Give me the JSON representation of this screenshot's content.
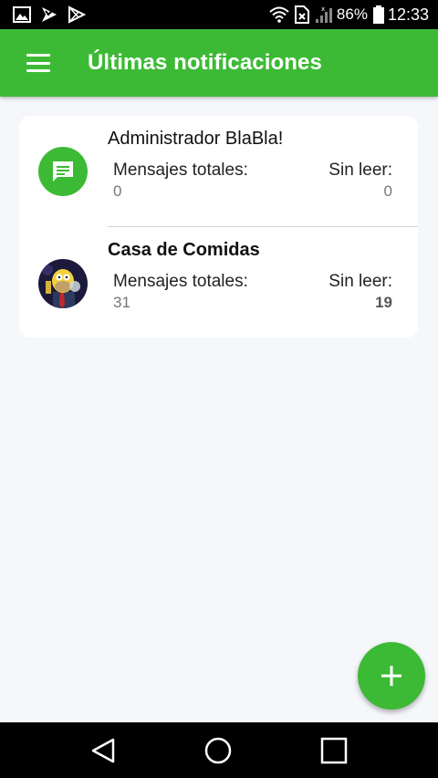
{
  "status_bar": {
    "battery_percent": "86%",
    "time": "12:33",
    "icons": [
      "image-icon",
      "download-icon",
      "play-store-icon",
      "wifi-icon",
      "sim-error-icon",
      "signal-icon",
      "battery-icon"
    ]
  },
  "app_bar": {
    "title": "Últimas notificaciones",
    "menu_icon": "menu-icon"
  },
  "notifications": [
    {
      "name": "Administrador BlaBla!",
      "avatar": "chat-icon",
      "total_label": "Mensajes totales:",
      "total_value": "0",
      "unread_label": "Sin leer:",
      "unread_value": "0",
      "bold": false
    },
    {
      "name": "Casa de Comidas",
      "avatar": "cartoon-avatar",
      "total_label": "Mensajes totales:",
      "total_value": "31",
      "unread_label": "Sin leer:",
      "unread_value": "19",
      "bold": true
    }
  ],
  "fab": {
    "icon": "plus-icon"
  },
  "nav_bar": {
    "icons": [
      "back-icon",
      "home-icon",
      "recents-icon"
    ]
  },
  "colors": {
    "primary": "#3dba35",
    "background": "#f6f7fb"
  }
}
